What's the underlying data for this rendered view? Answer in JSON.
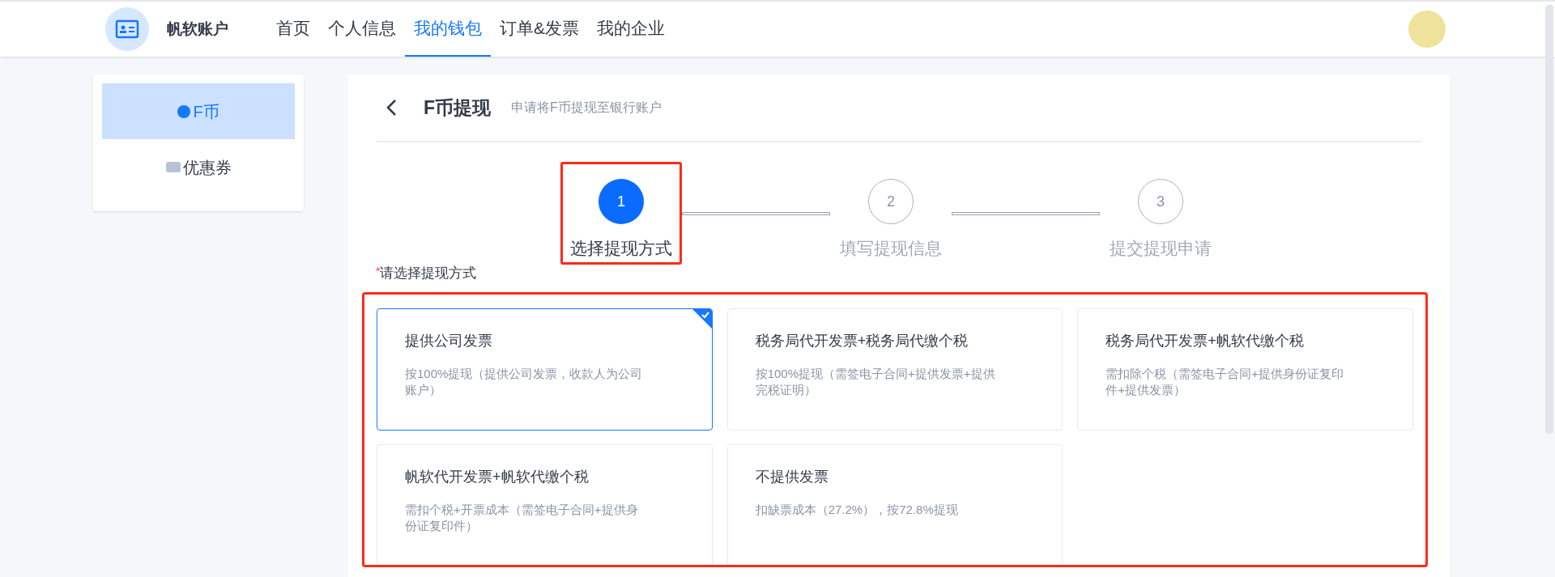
{
  "header": {
    "brand": "帆软账户",
    "nav": [
      {
        "label": "首页",
        "selected": false
      },
      {
        "label": "个人信息",
        "selected": false
      },
      {
        "label": "我的钱包",
        "selected": true
      },
      {
        "label": "订单&发票",
        "selected": false
      },
      {
        "label": "我的企业",
        "selected": false
      }
    ]
  },
  "sidebar": {
    "items": [
      {
        "label": "F币",
        "kind": "coin",
        "selected": true
      },
      {
        "label": "优惠券",
        "kind": "coupon",
        "selected": false
      }
    ]
  },
  "page": {
    "title": "F币提现",
    "subtitle": "申请将F币提现至银行账户",
    "steps": [
      {
        "number": "1",
        "label": "选择提现方式",
        "active": true,
        "highlighted": true
      },
      {
        "number": "2",
        "label": "填写提现信息",
        "active": false,
        "highlighted": false
      },
      {
        "number": "3",
        "label": "提交提现申请",
        "active": false,
        "highlighted": false
      }
    ],
    "field_label": "请选择提现方式",
    "required_mark": "*",
    "options": [
      {
        "title": "提供公司发票",
        "description": "按100%提现（提供公司发票，收款人为公司账户）",
        "selected": true
      },
      {
        "title": "税务局代开发票+税务局代缴个税",
        "description": "按100%提现（需签电子合同+提供发票+提供完税证明）",
        "selected": false
      },
      {
        "title": "税务局代开发票+帆软代缴个税",
        "description": "需扣除个税（需签电子合同+提供身份证复印件+提供发票）",
        "selected": false
      },
      {
        "title": "帆软代开发票+帆软代缴个税",
        "description": "需扣个税+开票成本（需签电子合同+提供身份证复印件）",
        "selected": false
      },
      {
        "title": "不提供发票",
        "description": "扣缺票成本（27.2%），按72.8%提现",
        "selected": false
      }
    ]
  }
}
